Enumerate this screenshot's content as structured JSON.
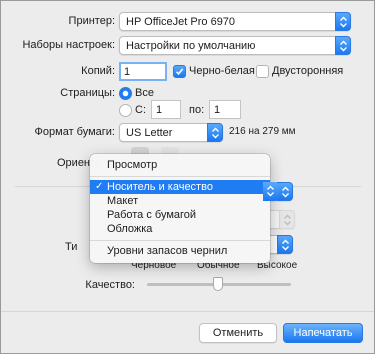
{
  "printer": {
    "label": "Принтер:",
    "value": "HP OfficeJet Pro 6970"
  },
  "presets": {
    "label": "Наборы настроек:",
    "value": "Настройки по умолчанию"
  },
  "copies": {
    "label": "Копий:",
    "value": "1",
    "bw_label": "Черно-белая",
    "bw_checked": true,
    "duplex_label": "Двусторонняя",
    "duplex_checked": false
  },
  "pages": {
    "label": "Страницы:",
    "all_label": "Все",
    "from_label": "С:",
    "from_value": "1",
    "to_label": "по:",
    "to_value": "1"
  },
  "paper": {
    "label": "Формат бумаги:",
    "value": "US Letter",
    "size_text": "216 на 279 мм"
  },
  "orientation": {
    "label": "Ориента"
  },
  "hidden_row": {
    "label": "Ти"
  },
  "menu": {
    "items": [
      {
        "label": "Просмотр",
        "checked": false,
        "selected": false
      },
      {
        "label": "Носитель и качество",
        "checked": true,
        "selected": true
      },
      {
        "label": "Макет",
        "checked": false,
        "selected": false
      },
      {
        "label": "Работа с бумагой",
        "checked": false,
        "selected": false
      },
      {
        "label": "Обложка",
        "checked": false,
        "selected": false
      },
      {
        "label": "Уровни запасов чернил",
        "checked": false,
        "selected": false
      }
    ]
  },
  "quality": {
    "label": "Качество:",
    "left": "Черновое",
    "middle": "Обычное",
    "right": "Высокое",
    "level": "Обычное"
  },
  "buttons": {
    "cancel": "Отменить",
    "print": "Напечатать"
  },
  "colors": {
    "accent": "#1f7cf3",
    "background": "#ececec"
  }
}
